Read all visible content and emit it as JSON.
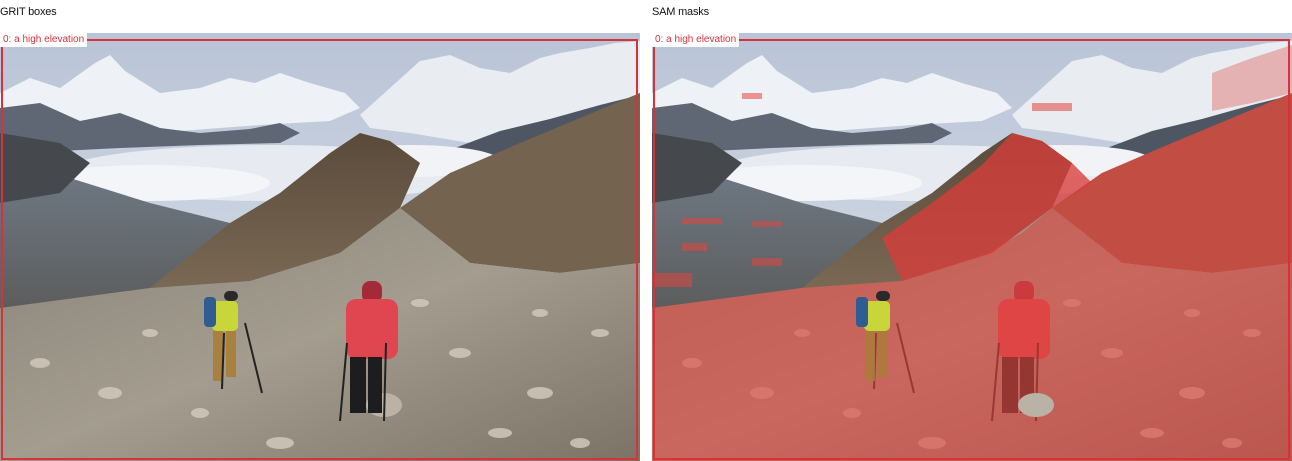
{
  "panels": [
    {
      "title": "GRIT boxes",
      "label": "0: a high elevation",
      "mode": "box"
    },
    {
      "title": "SAM masks",
      "label": "0: a high elevation",
      "mode": "mask"
    }
  ],
  "colors": {
    "annotation": "#d6323a",
    "mask_fill": "#e0453f"
  }
}
